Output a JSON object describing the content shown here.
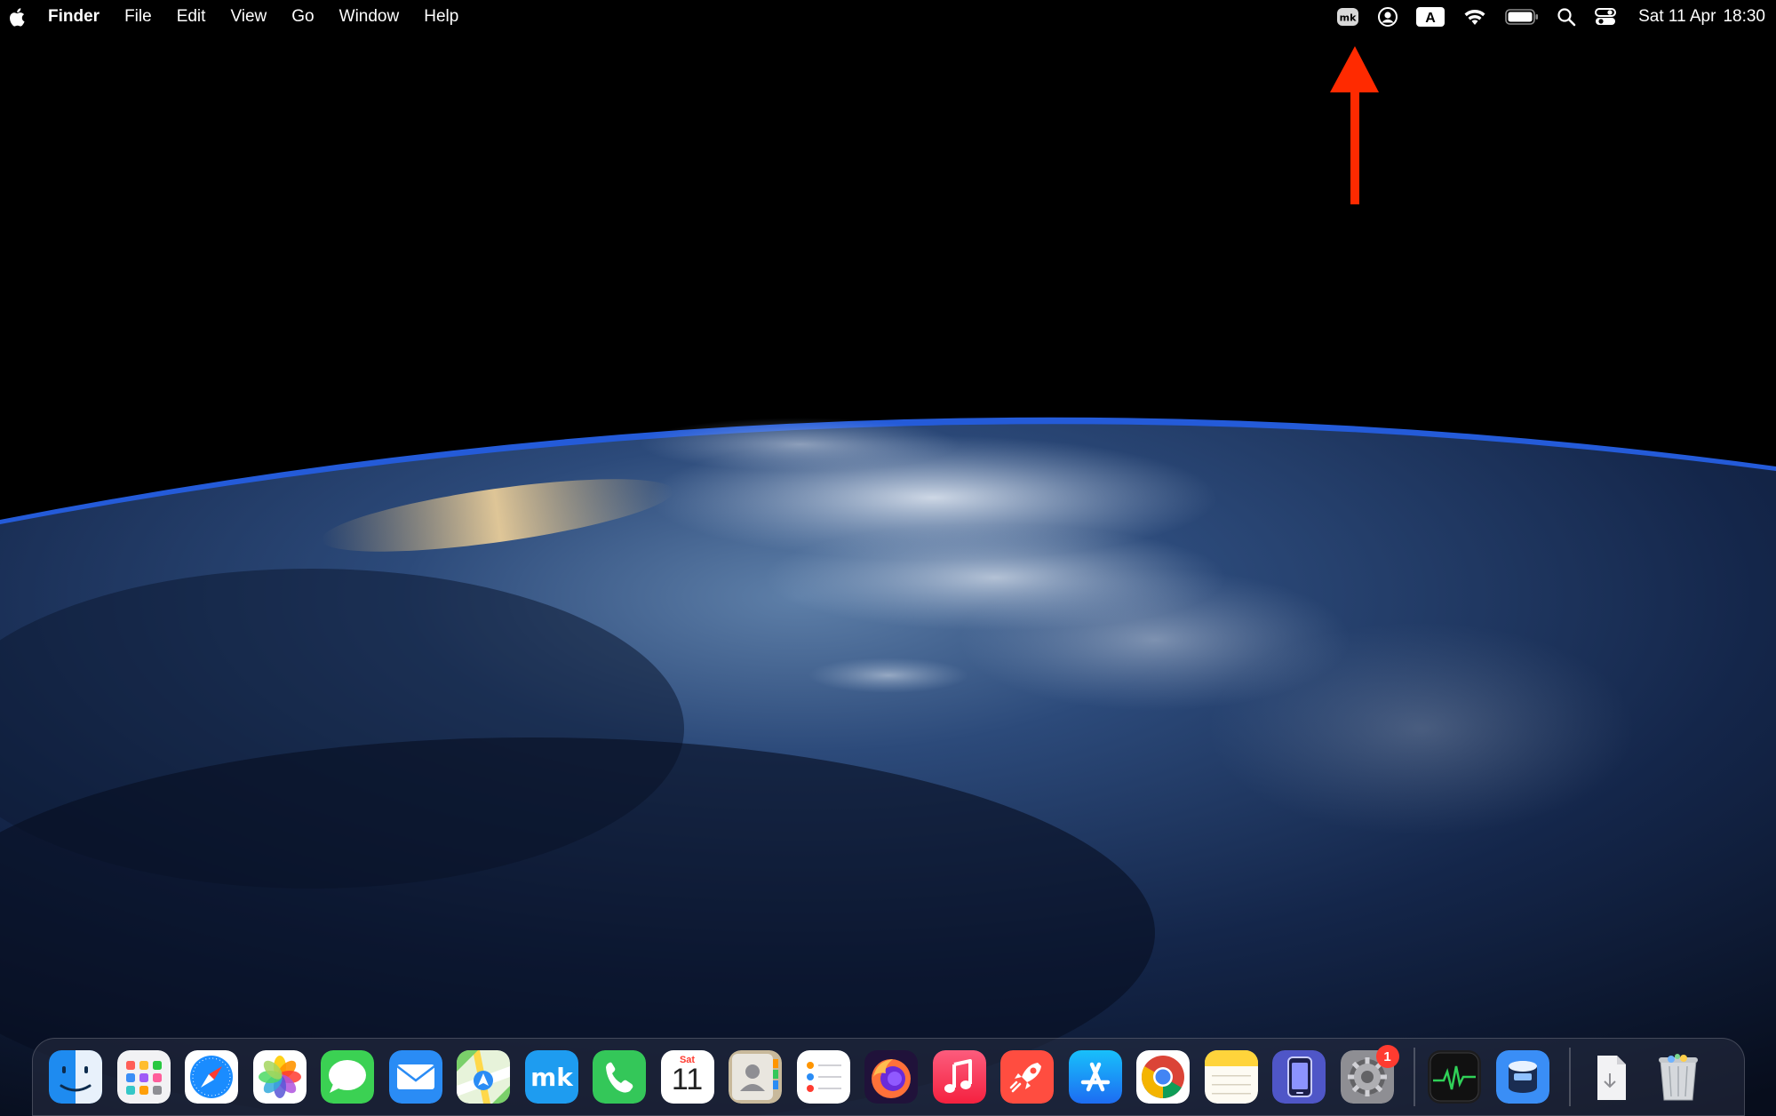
{
  "menubar": {
    "app_name": "Finder",
    "menus": [
      "File",
      "Edit",
      "View",
      "Go",
      "Window",
      "Help"
    ],
    "status_icons": [
      "mk-icon",
      "user-icon",
      "input-source-icon",
      "wifi-icon",
      "battery-icon",
      "spotlight-icon",
      "control-center-icon"
    ],
    "input_source_letter": "A",
    "mk_label": "mk",
    "date": "Sat 11 Apr",
    "time": "18:30"
  },
  "annotation": {
    "color": "#ff2a00"
  },
  "dock": {
    "apps": [
      "finder",
      "launchpad",
      "safari",
      "photos",
      "messages",
      "mail",
      "maps",
      "mk-app",
      "phone",
      "calendar",
      "contacts",
      "reminders",
      "firefox",
      "music",
      "rocket-app",
      "app-store",
      "chrome",
      "notes",
      "simulator",
      "system-settings"
    ],
    "calendar": {
      "weekday": "Sat",
      "day": "11"
    },
    "system_settings_badge": "1",
    "mk_label": "mk",
    "utilities": [
      "activity-monitor",
      "sequel-app"
    ],
    "trailing": [
      "downloads-stack",
      "trash"
    ]
  }
}
